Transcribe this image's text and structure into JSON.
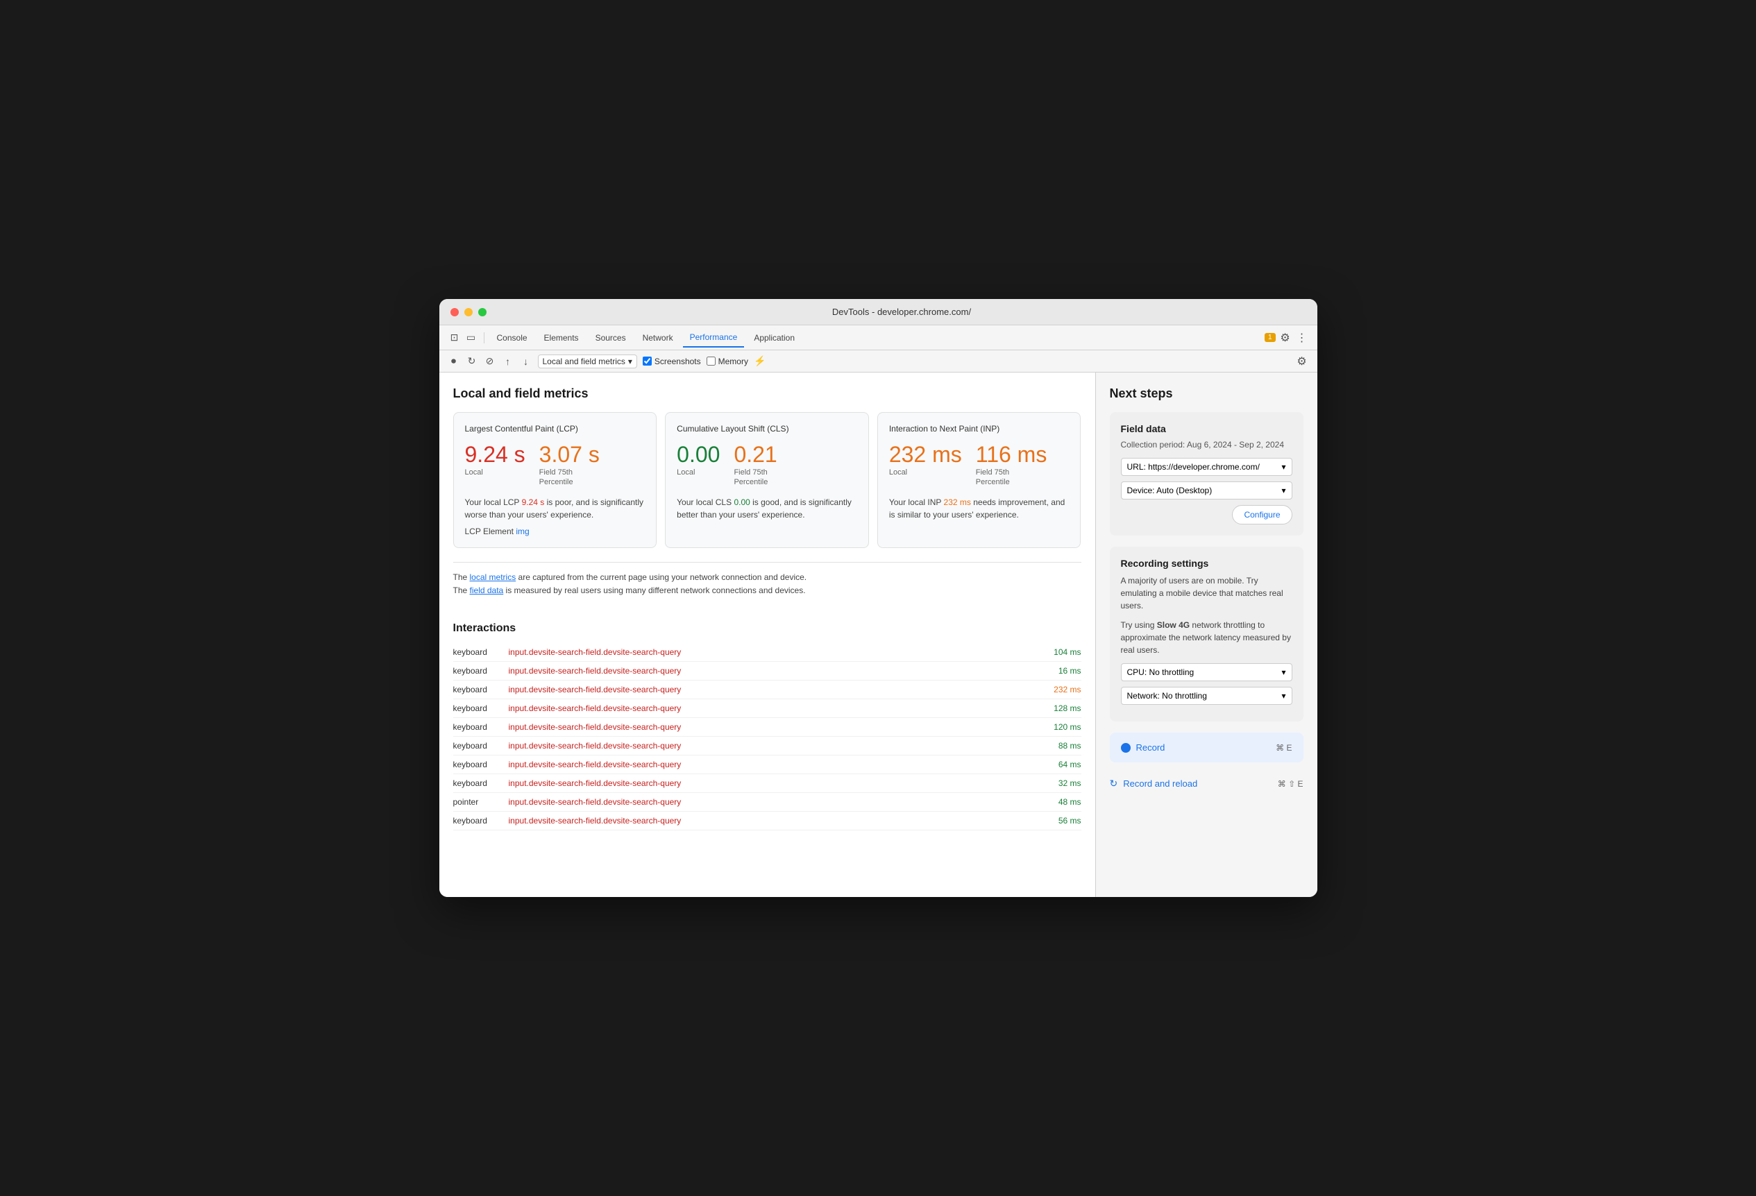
{
  "window": {
    "title": "DevTools - developer.chrome.com/"
  },
  "tabs": {
    "items": [
      {
        "label": "Console",
        "active": false
      },
      {
        "label": "Elements",
        "active": false
      },
      {
        "label": "Sources",
        "active": false
      },
      {
        "label": "Network",
        "active": false
      },
      {
        "label": "Performance",
        "active": true
      },
      {
        "label": "Application",
        "active": false
      }
    ],
    "badge": "1"
  },
  "subtoolbar": {
    "dropdown_label": "Local and field metrics",
    "screenshots_label": "Screenshots",
    "memory_label": "Memory"
  },
  "main": {
    "section_title": "Local and field metrics",
    "metrics": [
      {
        "title": "Largest Contentful Paint (LCP)",
        "local_value": "9.24 s",
        "field_value": "3.07 s",
        "local_label": "Local",
        "field_label": "Field 75th\nPercentile",
        "local_color": "red",
        "field_color": "orange",
        "description": "Your local LCP 9.24 s is poor, and is significantly worse than your users' experience.",
        "desc_highlight": "9.24 s",
        "desc_color": "red",
        "extra": "LCP Element img"
      },
      {
        "title": "Cumulative Layout Shift (CLS)",
        "local_value": "0.00",
        "field_value": "0.21",
        "local_label": "Local",
        "field_label": "Field 75th\nPercentile",
        "local_color": "green",
        "field_color": "orange",
        "description": "Your local CLS 0.00 is good, and is significantly better than your users' experience.",
        "desc_highlight": "0.00",
        "desc_color": "green"
      },
      {
        "title": "Interaction to Next Paint (INP)",
        "local_value": "232 ms",
        "field_value": "116 ms",
        "local_label": "Local",
        "field_label": "Field 75th\nPercentile",
        "local_color": "orange",
        "field_color": "orange",
        "description": "Your local INP 232 ms needs improvement, and is similar to your users' experience.",
        "desc_highlight": "232 ms",
        "desc_color": "orange"
      }
    ],
    "info_line1": "The local metrics are captured from the current page using your network connection and device.",
    "info_line2": "The field data is measured by real users using many different network connections and devices.",
    "info_link1": "local metrics",
    "info_link2": "field data",
    "interactions_title": "Interactions",
    "interactions": [
      {
        "type": "keyboard",
        "element": "input.devsite-search-field.devsite-search-query",
        "time": "104 ms",
        "color": "green"
      },
      {
        "type": "keyboard",
        "element": "input.devsite-search-field.devsite-search-query",
        "time": "16 ms",
        "color": "green"
      },
      {
        "type": "keyboard",
        "element": "input.devsite-search-field.devsite-search-query",
        "time": "232 ms",
        "color": "orange"
      },
      {
        "type": "keyboard",
        "element": "input.devsite-search-field.devsite-search-query",
        "time": "128 ms",
        "color": "green"
      },
      {
        "type": "keyboard",
        "element": "input.devsite-search-field.devsite-search-query",
        "time": "120 ms",
        "color": "green"
      },
      {
        "type": "keyboard",
        "element": "input.devsite-search-field.devsite-search-query",
        "time": "88 ms",
        "color": "green"
      },
      {
        "type": "keyboard",
        "element": "input.devsite-search-field.devsite-search-query",
        "time": "64 ms",
        "color": "green"
      },
      {
        "type": "keyboard",
        "element": "input.devsite-search-field.devsite-search-query",
        "time": "32 ms",
        "color": "green"
      },
      {
        "type": "pointer",
        "element": "input.devsite-search-field.devsite-search-query",
        "time": "48 ms",
        "color": "green"
      },
      {
        "type": "keyboard",
        "element": "input.devsite-search-field.devsite-search-query",
        "time": "56 ms",
        "color": "green"
      }
    ]
  },
  "right_panel": {
    "title": "Next steps",
    "field_data": {
      "title": "Field data",
      "collection_period": "Collection period: Aug 6, 2024 - Sep 2, 2024",
      "url_label": "URL: https://developer.chrome.com/",
      "device_label": "Device: Auto (Desktop)",
      "configure_label": "Configure"
    },
    "recording_settings": {
      "title": "Recording settings",
      "text1": "A majority of users are on mobile. Try emulating a mobile device that matches real users.",
      "text2_prefix": "Try using ",
      "text2_highlight": "Slow 4G",
      "text2_suffix": " network throttling to approximate the network latency measured by real users.",
      "cpu_label": "CPU: No throttling",
      "network_label": "Network: No throttling"
    },
    "record": {
      "label": "Record",
      "shortcut": "⌘ E"
    },
    "record_reload": {
      "label": "Record and reload",
      "shortcut": "⌘ ⇧ E"
    }
  }
}
